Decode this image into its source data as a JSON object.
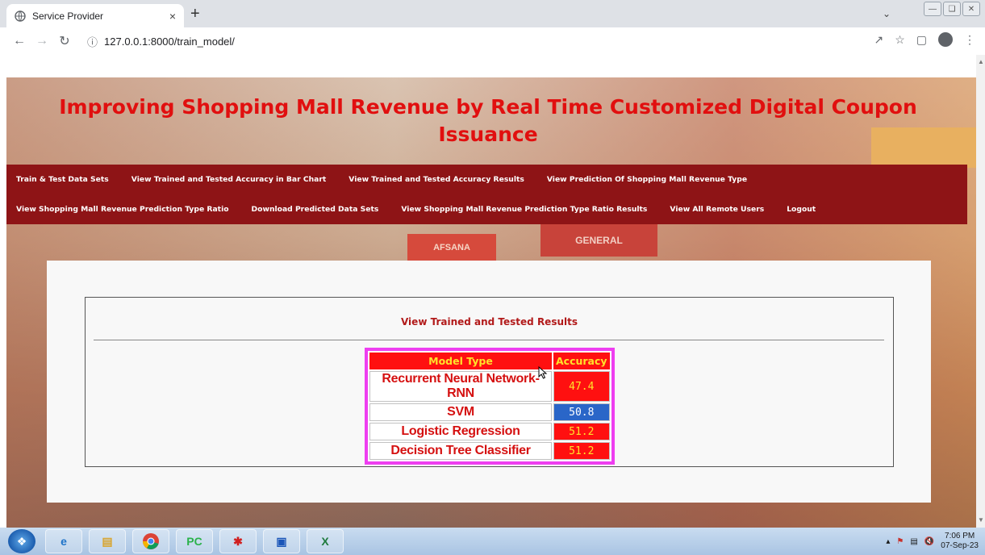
{
  "browser": {
    "tab_title": "Service Provider",
    "tab_close": "×",
    "new_tab": "+",
    "url": "127.0.0.1:8000/train_model/"
  },
  "page": {
    "title": "Improving Shopping Mall Revenue by Real Time Customized Digital Coupon Issuance",
    "nav_row1": [
      "Train & Test Data Sets",
      "View Trained and Tested Accuracy in Bar Chart",
      "View Trained and Tested Accuracy Results",
      "View Prediction Of Shopping Mall Revenue Type"
    ],
    "nav_row2": [
      "View Shopping Mall Revenue Prediction Type Ratio",
      "Download Predicted Data Sets",
      "View Shopping Mall Revenue Prediction Type Ratio Results",
      "View All Remote Users",
      "Logout"
    ],
    "sign_left": "AFSANA",
    "sign_right": "GENERAL",
    "results": {
      "heading": "View Trained and Tested Results",
      "columns": [
        "Model Type",
        "Accuracy"
      ],
      "rows": [
        {
          "model": "Recurrent Neural Network-RNN",
          "accuracy": "47.4"
        },
        {
          "model": "SVM",
          "accuracy": "50.8"
        },
        {
          "model": "Logistic Regression",
          "accuracy": "51.2"
        },
        {
          "model": "Decision Tree Classifier",
          "accuracy": "51.2"
        }
      ]
    }
  },
  "taskbar": {
    "time": "7:06 PM",
    "date": "07-Sep-23"
  }
}
